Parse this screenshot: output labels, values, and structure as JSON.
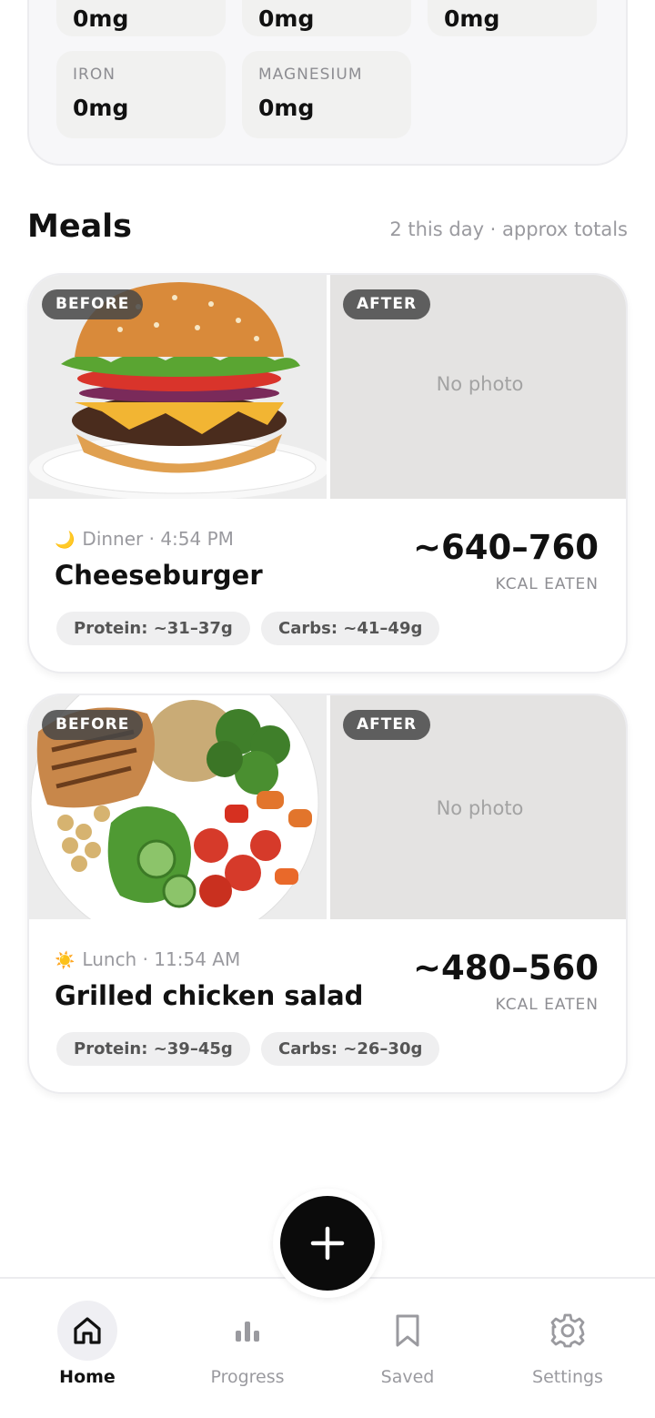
{
  "minerals": {
    "tiles": [
      {
        "value": "0mg"
      },
      {
        "value": "0mg"
      },
      {
        "value": "0mg"
      },
      {
        "label": "IRON",
        "value": "0mg"
      },
      {
        "label": "MAGNESIUM",
        "value": "0mg"
      }
    ]
  },
  "meals": {
    "title": "Meals",
    "meta": "2 this day · approx totals",
    "items": [
      {
        "before_label": "BEFORE",
        "after_label": "AFTER",
        "no_photo": "No photo",
        "time": "Dinner · 4:54 PM",
        "icon": "moon-icon",
        "icon_glyph": "🌙",
        "name": "Cheeseburger",
        "kcal": "~640–760",
        "kcal_label": "KCAL EATEN",
        "protein": "Protein: ~31–37g",
        "carbs": "Carbs: ~41–49g"
      },
      {
        "before_label": "BEFORE",
        "after_label": "AFTER",
        "no_photo": "No photo",
        "time": "Lunch · 11:54 AM",
        "icon": "sun-icon",
        "icon_glyph": "☀️",
        "name": "Grilled chicken salad",
        "kcal": "~480–560",
        "kcal_label": "KCAL EATEN",
        "protein": "Protein: ~39–45g",
        "carbs": "Carbs: ~26–30g"
      }
    ]
  },
  "nav": {
    "items": [
      {
        "label": "Home",
        "icon": "home-icon",
        "active": true
      },
      {
        "label": "Progress",
        "icon": "bar-chart-icon",
        "active": false
      },
      {
        "label": "Saved",
        "icon": "bookmark-icon",
        "active": false
      },
      {
        "label": "Settings",
        "icon": "gear-icon",
        "active": false
      }
    ]
  },
  "colors": {
    "accent": "#0b0b0b",
    "muted_text": "#9a9a9f",
    "card_border": "#ececef"
  }
}
